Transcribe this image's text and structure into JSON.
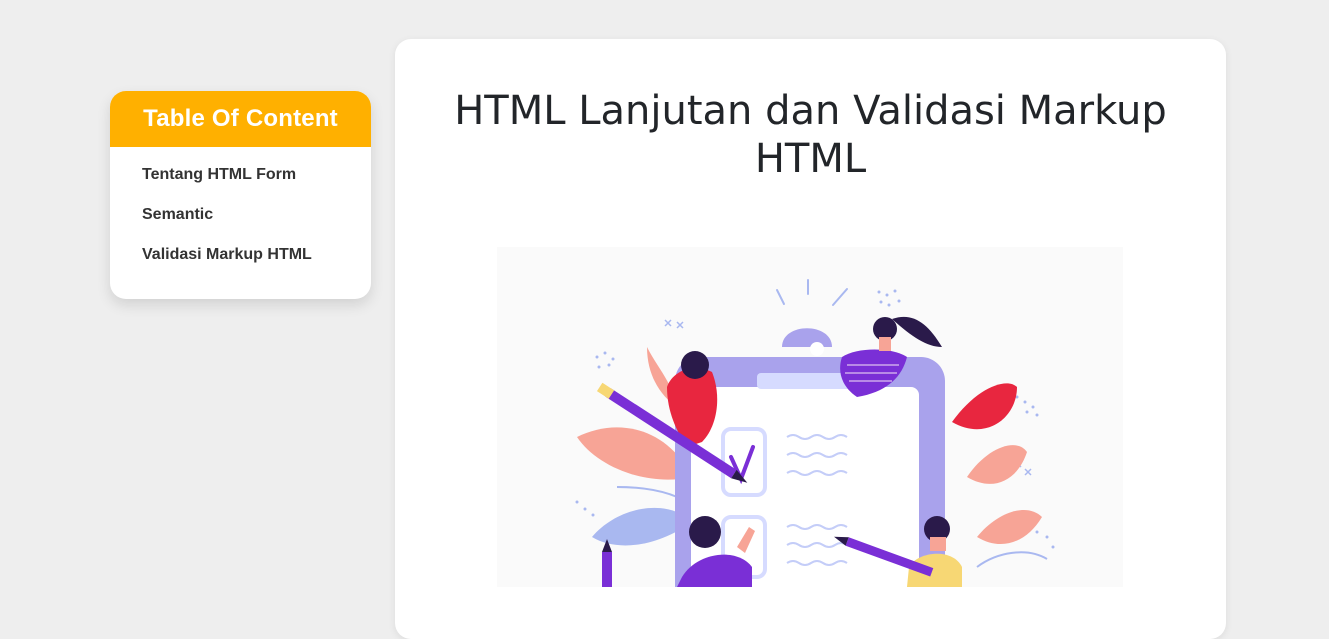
{
  "toc": {
    "title": "Table Of Content",
    "items": [
      {
        "label": "Tentang HTML Form"
      },
      {
        "label": "Semantic"
      },
      {
        "label": "Validasi Markup HTML"
      }
    ]
  },
  "article": {
    "title": "HTML Lanjutan dan Validasi Markup HTML"
  },
  "colors": {
    "page_bg": "#eeeeee",
    "toc_header": "#ffb000",
    "card_bg": "#ffffff",
    "clipboard": "#a9a2ec",
    "accent_red": "#e8263f",
    "accent_purple": "#7a2fd6",
    "accent_pink": "#f7a496"
  }
}
